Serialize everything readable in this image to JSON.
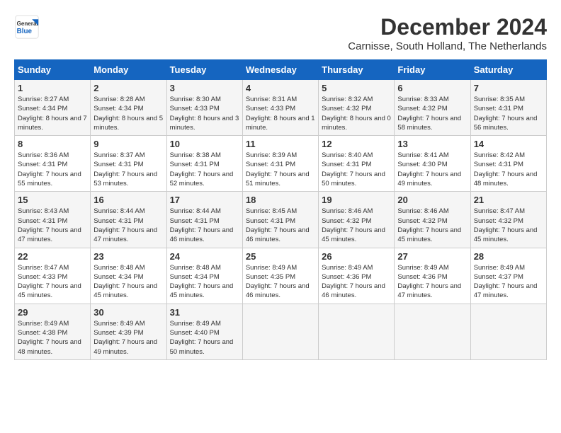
{
  "header": {
    "logo": {
      "general": "General",
      "blue": "Blue"
    },
    "title": "December 2024",
    "location": "Carnisse, South Holland, The Netherlands"
  },
  "days_of_week": [
    "Sunday",
    "Monday",
    "Tuesday",
    "Wednesday",
    "Thursday",
    "Friday",
    "Saturday"
  ],
  "weeks": [
    [
      {
        "day": 1,
        "sunrise": "8:27 AM",
        "sunset": "4:34 PM",
        "daylight": "8 hours and 7 minutes."
      },
      {
        "day": 2,
        "sunrise": "8:28 AM",
        "sunset": "4:34 PM",
        "daylight": "8 hours and 5 minutes."
      },
      {
        "day": 3,
        "sunrise": "8:30 AM",
        "sunset": "4:33 PM",
        "daylight": "8 hours and 3 minutes."
      },
      {
        "day": 4,
        "sunrise": "8:31 AM",
        "sunset": "4:33 PM",
        "daylight": "8 hours and 1 minute."
      },
      {
        "day": 5,
        "sunrise": "8:32 AM",
        "sunset": "4:32 PM",
        "daylight": "8 hours and 0 minutes."
      },
      {
        "day": 6,
        "sunrise": "8:33 AM",
        "sunset": "4:32 PM",
        "daylight": "7 hours and 58 minutes."
      },
      {
        "day": 7,
        "sunrise": "8:35 AM",
        "sunset": "4:31 PM",
        "daylight": "7 hours and 56 minutes."
      }
    ],
    [
      {
        "day": 8,
        "sunrise": "8:36 AM",
        "sunset": "4:31 PM",
        "daylight": "7 hours and 55 minutes."
      },
      {
        "day": 9,
        "sunrise": "8:37 AM",
        "sunset": "4:31 PM",
        "daylight": "7 hours and 53 minutes."
      },
      {
        "day": 10,
        "sunrise": "8:38 AM",
        "sunset": "4:31 PM",
        "daylight": "7 hours and 52 minutes."
      },
      {
        "day": 11,
        "sunrise": "8:39 AM",
        "sunset": "4:31 PM",
        "daylight": "7 hours and 51 minutes."
      },
      {
        "day": 12,
        "sunrise": "8:40 AM",
        "sunset": "4:31 PM",
        "daylight": "7 hours and 50 minutes."
      },
      {
        "day": 13,
        "sunrise": "8:41 AM",
        "sunset": "4:30 PM",
        "daylight": "7 hours and 49 minutes."
      },
      {
        "day": 14,
        "sunrise": "8:42 AM",
        "sunset": "4:31 PM",
        "daylight": "7 hours and 48 minutes."
      }
    ],
    [
      {
        "day": 15,
        "sunrise": "8:43 AM",
        "sunset": "4:31 PM",
        "daylight": "7 hours and 47 minutes."
      },
      {
        "day": 16,
        "sunrise": "8:44 AM",
        "sunset": "4:31 PM",
        "daylight": "7 hours and 47 minutes."
      },
      {
        "day": 17,
        "sunrise": "8:44 AM",
        "sunset": "4:31 PM",
        "daylight": "7 hours and 46 minutes."
      },
      {
        "day": 18,
        "sunrise": "8:45 AM",
        "sunset": "4:31 PM",
        "daylight": "7 hours and 46 minutes."
      },
      {
        "day": 19,
        "sunrise": "8:46 AM",
        "sunset": "4:32 PM",
        "daylight": "7 hours and 45 minutes."
      },
      {
        "day": 20,
        "sunrise": "8:46 AM",
        "sunset": "4:32 PM",
        "daylight": "7 hours and 45 minutes."
      },
      {
        "day": 21,
        "sunrise": "8:47 AM",
        "sunset": "4:32 PM",
        "daylight": "7 hours and 45 minutes."
      }
    ],
    [
      {
        "day": 22,
        "sunrise": "8:47 AM",
        "sunset": "4:33 PM",
        "daylight": "7 hours and 45 minutes."
      },
      {
        "day": 23,
        "sunrise": "8:48 AM",
        "sunset": "4:34 PM",
        "daylight": "7 hours and 45 minutes."
      },
      {
        "day": 24,
        "sunrise": "8:48 AM",
        "sunset": "4:34 PM",
        "daylight": "7 hours and 45 minutes."
      },
      {
        "day": 25,
        "sunrise": "8:49 AM",
        "sunset": "4:35 PM",
        "daylight": "7 hours and 46 minutes."
      },
      {
        "day": 26,
        "sunrise": "8:49 AM",
        "sunset": "4:36 PM",
        "daylight": "7 hours and 46 minutes."
      },
      {
        "day": 27,
        "sunrise": "8:49 AM",
        "sunset": "4:36 PM",
        "daylight": "7 hours and 47 minutes."
      },
      {
        "day": 28,
        "sunrise": "8:49 AM",
        "sunset": "4:37 PM",
        "daylight": "7 hours and 47 minutes."
      }
    ],
    [
      {
        "day": 29,
        "sunrise": "8:49 AM",
        "sunset": "4:38 PM",
        "daylight": "7 hours and 48 minutes."
      },
      {
        "day": 30,
        "sunrise": "8:49 AM",
        "sunset": "4:39 PM",
        "daylight": "7 hours and 49 minutes."
      },
      {
        "day": 31,
        "sunrise": "8:49 AM",
        "sunset": "4:40 PM",
        "daylight": "7 hours and 50 minutes."
      },
      null,
      null,
      null,
      null
    ]
  ],
  "labels": {
    "sunrise": "Sunrise:",
    "sunset": "Sunset:",
    "daylight": "Daylight:"
  }
}
